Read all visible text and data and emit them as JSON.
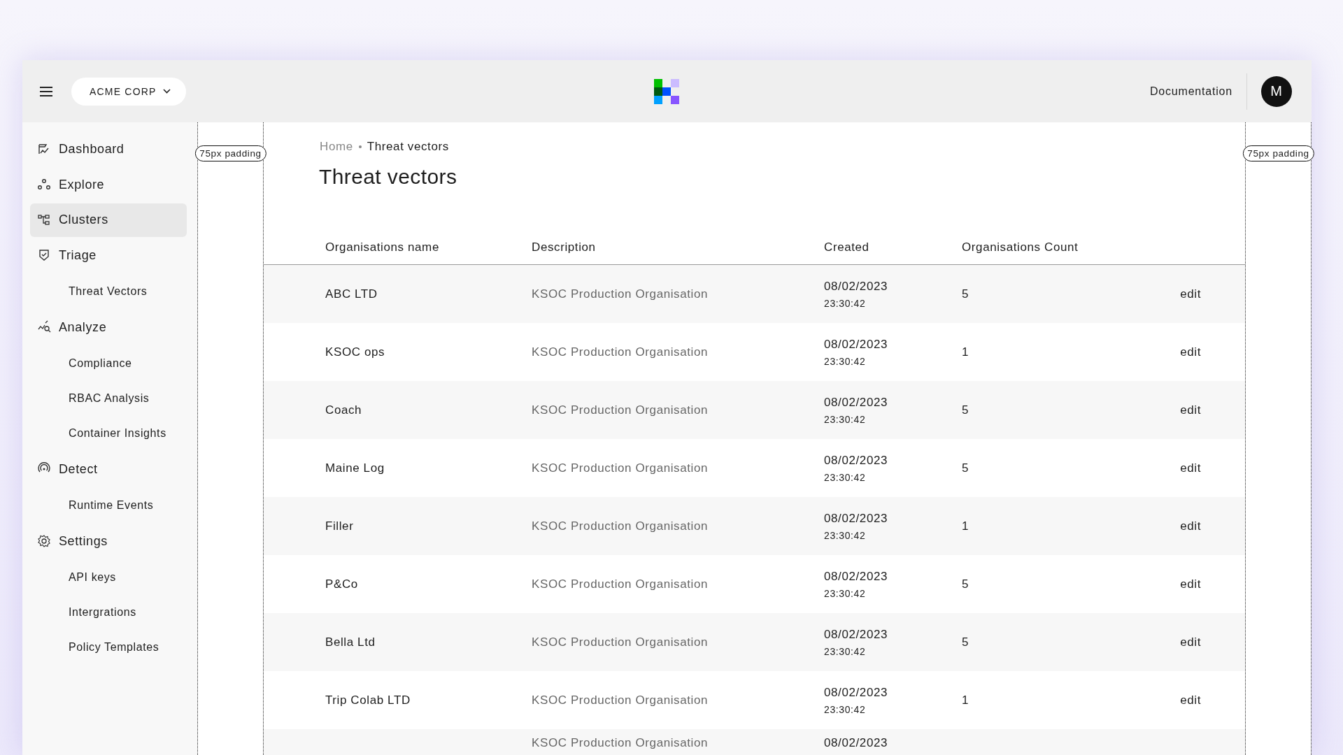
{
  "topbar": {
    "org": "ACME CORP",
    "link": "Documentation",
    "avatar": "M"
  },
  "sidebar": {
    "items": [
      {
        "label": "Dashboard",
        "selected": false
      },
      {
        "label": "Explore",
        "selected": false
      },
      {
        "label": "Clusters",
        "selected": true
      },
      {
        "label": "Triage",
        "selected": false,
        "children": [
          {
            "label": "Threat Vectors",
            "selected": false
          }
        ]
      },
      {
        "label": "Analyze",
        "selected": false,
        "children": [
          {
            "label": "Compliance",
            "selected": false
          },
          {
            "label": "RBAC Analysis",
            "selected": false
          },
          {
            "label": "Container Insights",
            "selected": false
          }
        ]
      },
      {
        "label": "Detect",
        "selected": false,
        "children": [
          {
            "label": "Runtime Events",
            "selected": false
          }
        ]
      },
      {
        "label": "Settings",
        "selected": false,
        "children": [
          {
            "label": "API keys",
            "selected": false
          },
          {
            "label": "Intergrations",
            "selected": false
          },
          {
            "label": "Policy Templates",
            "selected": false
          }
        ]
      }
    ]
  },
  "padding_labels": [
    "75px padding",
    "75px padding"
  ],
  "breadcrumb": [
    "Home",
    "Threat vectors"
  ],
  "title": "Threat vectors",
  "table": {
    "columns": [
      "Organisations name",
      "Description",
      "Created",
      "Organisations Count"
    ],
    "rows": [
      {
        "name": "ABC LTD",
        "description": "KSOC Production Organisation",
        "date": "08/02/2023",
        "time": "23:30:42",
        "count": "5",
        "action": "edit"
      },
      {
        "name": "KSOC ops",
        "description": "KSOC Production Organisation",
        "date": "08/02/2023",
        "time": "23:30:42",
        "count": "1",
        "action": "edit"
      },
      {
        "name": "Coach",
        "description": "KSOC Production Organisation",
        "date": "08/02/2023",
        "time": "23:30:42",
        "count": "5",
        "action": "edit"
      },
      {
        "name": "Maine Log",
        "description": "KSOC Production Organisation",
        "date": "08/02/2023",
        "time": "23:30:42",
        "count": "5",
        "action": "edit"
      },
      {
        "name": "Filler",
        "description": "KSOC Production Organisation",
        "date": "08/02/2023",
        "time": "23:30:42",
        "count": "1",
        "action": "edit"
      },
      {
        "name": "P&Co",
        "description": "KSOC Production Organisation",
        "date": "08/02/2023",
        "time": "23:30:42",
        "count": "5",
        "action": "edit"
      },
      {
        "name": "Bella Ltd",
        "description": "KSOC Production Organisation",
        "date": "08/02/2023",
        "time": "23:30:42",
        "count": "5",
        "action": "edit"
      },
      {
        "name": "Trip Colab LTD",
        "description": "KSOC Production Organisation",
        "date": "08/02/2023",
        "time": "23:30:42",
        "count": "1",
        "action": "edit"
      },
      {
        "description": "KSOC Production Organisation",
        "date": "08/02/2023"
      }
    ]
  }
}
